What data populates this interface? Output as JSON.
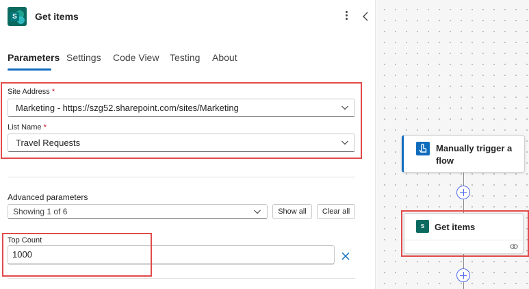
{
  "panel": {
    "title": "Get items",
    "tabs": [
      {
        "label": "Parameters",
        "active": true
      },
      {
        "label": "Settings",
        "active": false
      },
      {
        "label": "Code View",
        "active": false
      },
      {
        "label": "Testing",
        "active": false
      },
      {
        "label": "About",
        "active": false
      }
    ],
    "site_address": {
      "label": "Site Address",
      "required_mark": "*",
      "value": "Marketing - https://szg52.sharepoint.com/sites/Marketing"
    },
    "list_name": {
      "label": "List Name",
      "required_mark": "*",
      "value": "Travel Requests"
    },
    "advanced": {
      "label": "Advanced parameters",
      "value": "Showing 1 of 6",
      "show_all": "Show all",
      "clear_all": "Clear all"
    },
    "top_count": {
      "label": "Top Count",
      "value": "1000"
    }
  },
  "canvas": {
    "trigger_card": {
      "title": "Manually trigger a flow"
    },
    "get_items_card": {
      "title": "Get items"
    }
  },
  "colors": {
    "accent": "#0f6cbd",
    "highlight": "#e14a4a",
    "sharepoint": "#0b6a5f",
    "required": "#c50f1f"
  }
}
